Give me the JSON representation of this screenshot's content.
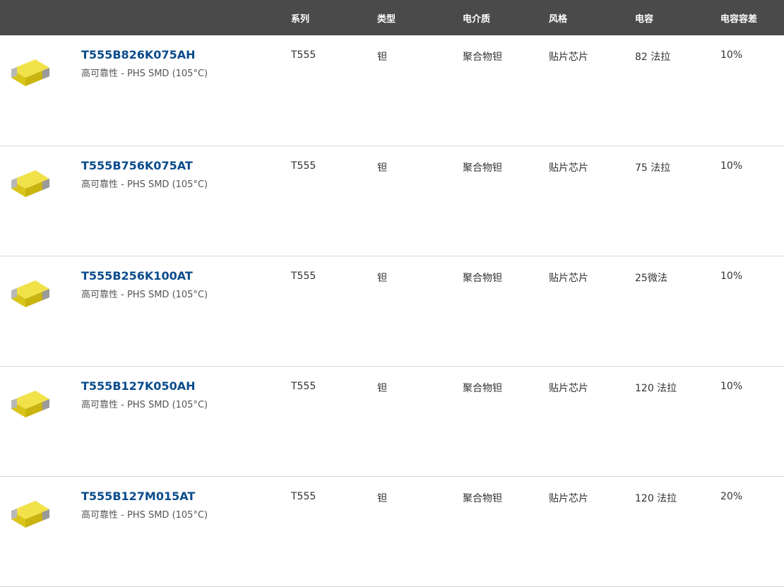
{
  "header": {
    "columns": [
      "系列",
      "类型",
      "电介质",
      "风格",
      "电容",
      "电容容差"
    ]
  },
  "rows": [
    {
      "part_number": "T555B826K075AH",
      "description": "高可靠性 - PHS SMD (105°C)",
      "series": "T555",
      "type": "钽",
      "dielectric": "聚合物钽",
      "style": "贴片芯片",
      "capacitance": "82 法拉",
      "tolerance": "10%",
      "image_icon": "yellow-tantalum-capacitor"
    },
    {
      "part_number": "T555B756K075AT",
      "description": "高可靠性 - PHS SMD (105°C)",
      "series": "T555",
      "type": "钽",
      "dielectric": "聚合物钽",
      "style": "贴片芯片",
      "capacitance": "75 法拉",
      "tolerance": "10%",
      "image_icon": "yellow-tantalum-capacitor"
    },
    {
      "part_number": "T555B256K100AT",
      "description": "高可靠性 - PHS SMD (105°C)",
      "series": "T555",
      "type": "钽",
      "dielectric": "聚合物钽",
      "style": "贴片芯片",
      "capacitance": "25微法",
      "tolerance": "10%",
      "image_icon": "yellow-tantalum-capacitor"
    },
    {
      "part_number": "T555B127K050AH",
      "description": "高可靠性 - PHS SMD (105°C)",
      "series": "T555",
      "type": "钽",
      "dielectric": "聚合物钽",
      "style": "贴片芯片",
      "capacitance": "120 法拉",
      "tolerance": "10%",
      "image_icon": "yellow-tantalum-capacitor"
    },
    {
      "part_number": "T555B127M015AT",
      "description": "高可靠性 - PHS SMD (105°C)",
      "series": "T555",
      "type": "钽",
      "dielectric": "聚合物钽",
      "style": "贴片芯片",
      "capacitance": "120 法拉",
      "tolerance": "20%",
      "image_icon": "yellow-tantalum-capacitor"
    }
  ],
  "colors": {
    "header_bg": "#4a4a4a",
    "link": "#0b4c8c",
    "capacitor_body": "#e8d82a"
  }
}
